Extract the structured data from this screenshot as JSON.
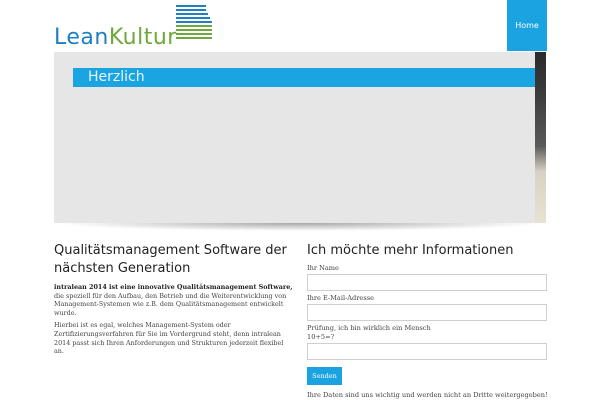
{
  "header": {
    "logo_part1": "Lean",
    "logo_part2": "Kultur",
    "nav_home": "Home",
    "colors": {
      "accent": "#1aa3e0",
      "logo_blue": "#1f7fc0",
      "logo_green": "#6fa83a"
    }
  },
  "hero": {
    "banner_text": "Herzlich"
  },
  "left": {
    "title": "Qualitätsmanagement Software der nächsten Generation",
    "p1_bold": "intralean 2014 ist eine innovative Qualitätsmanagement Software,",
    "p1_rest": " die speziell für den Aufbau, den Betrieb und die Weiterentwicklung von Management-Systemen wie z.B. dem Qualitätsmanagement entwickelt wurde.",
    "p2": "Hierbei ist es egal, welches Management-System oder Zertifizierungsverfahren für Sie im Vordergrund steht, denn intralean 2014 passt sich Ihren Anforderungen und Strukturen jederzeit flexibel an."
  },
  "form": {
    "title": "Ich möchte mehr Informationen",
    "name_label": "Ihr Name",
    "email_label": "Ihre E-Mail-Adresse",
    "check_label": "Prüfung, ich bin wirklich ein Mensch",
    "check_question": "10+5=?",
    "name_value": "",
    "email_value": "",
    "check_value": "",
    "submit_label": "Senden",
    "privacy_note": "Ihre Daten sind uns wichtig und werden nicht an Dritte weitergegeben!"
  }
}
